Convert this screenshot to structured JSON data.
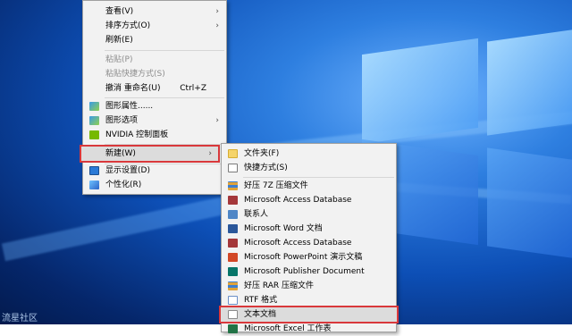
{
  "context_menu": {
    "items": [
      {
        "label": "查看(V)",
        "arrow": "›"
      },
      {
        "label": "排序方式(O)",
        "arrow": "›"
      },
      {
        "label": "刷新(E)"
      },
      {
        "label": "粘贴(P)"
      },
      {
        "label": "粘贴快捷方式(S)"
      },
      {
        "label": "撤消 重命名(U)",
        "shortcut": "Ctrl+Z"
      },
      {
        "label": "图形属性......"
      },
      {
        "label": "图形选项",
        "arrow": "›"
      },
      {
        "label": "NVIDIA 控制面板"
      },
      {
        "label": "新建(W)",
        "arrow": "›"
      },
      {
        "label": "显示设置(D)"
      },
      {
        "label": "个性化(R)"
      }
    ]
  },
  "new_submenu": {
    "items": [
      {
        "label": "文件夹(F)"
      },
      {
        "label": "快捷方式(S)"
      },
      {
        "label": "好压 7Z 压缩文件"
      },
      {
        "label": "Microsoft Access Database"
      },
      {
        "label": "联系人"
      },
      {
        "label": "Microsoft Word 文档"
      },
      {
        "label": "Microsoft Access Database"
      },
      {
        "label": "Microsoft PowerPoint 演示文稿"
      },
      {
        "label": "Microsoft Publisher Document"
      },
      {
        "label": "好压 RAR 压缩文件"
      },
      {
        "label": "RTF 格式"
      },
      {
        "label": "文本文档"
      },
      {
        "label": "Microsoft Excel 工作表"
      }
    ]
  },
  "watermark": "流星社区",
  "colors": {
    "highlight_border": "#d9383b",
    "menu_bg": "#f2f2f2"
  }
}
